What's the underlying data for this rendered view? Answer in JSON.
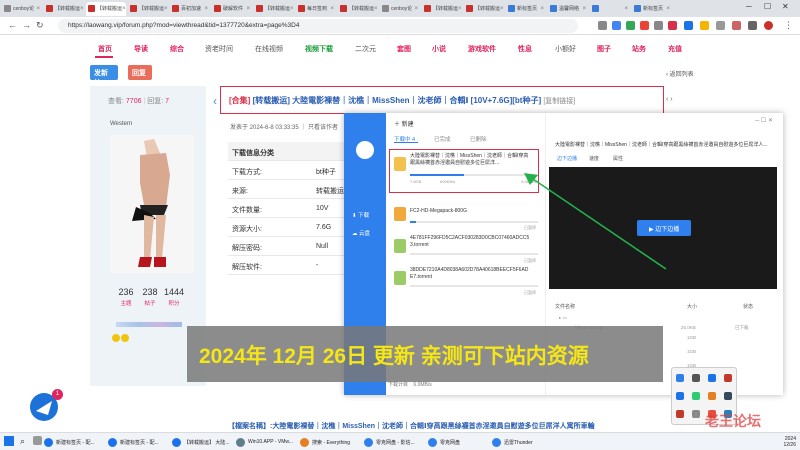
{
  "browser": {
    "tabs": [
      {
        "label": "cenboy论",
        "color": "#888"
      },
      {
        "label": "【转载搬运",
        "color": "#c9302c"
      },
      {
        "label": "【转载搬运",
        "color": "#c9302c"
      },
      {
        "label": "【转载搬运",
        "color": "#c9302c"
      },
      {
        "label": "百初加速",
        "color": "#c9302c"
      },
      {
        "label": "破解软件",
        "color": "#c9302c"
      },
      {
        "label": "【转载搬运",
        "color": "#c9302c"
      },
      {
        "label": "每日签到",
        "color": "#c9302c"
      },
      {
        "label": "【转载搬运",
        "color": "#c9302c"
      },
      {
        "label": "cenboy论",
        "color": "#888"
      },
      {
        "label": "【转载搬运",
        "color": "#c9302c"
      },
      {
        "label": "【转载搬运",
        "color": "#c9302c"
      },
      {
        "label": "新标签页",
        "color": "#3a7bd5"
      },
      {
        "label": "温馨网络",
        "color": "#3a7bd5"
      },
      {
        "label": "",
        "color": "#3a7bd5"
      },
      {
        "label": "新标签页",
        "color": "#3a7bd5"
      }
    ],
    "url": "https://laowang.vip/forum.php?mod=viewthread&tid=1377720&extra=page%3D4"
  },
  "site_nav": {
    "items": [
      "首页",
      "导读",
      "综合",
      "资老时间",
      "在线视频",
      "视频下载",
      "二次元",
      "套图",
      "小说",
      "游戏软件",
      "性息",
      "小额好",
      "图子",
      "站务",
      "充值"
    ]
  },
  "actions": {
    "post": "发新帖",
    "reply": "回复",
    "back_list": "返回列表"
  },
  "user": {
    "views_label": "查看:",
    "views": "7706",
    "replies_label": "回复:",
    "replies": "7",
    "name": "Western",
    "stats": [
      {
        "value": "236",
        "label": "主题"
      },
      {
        "value": "238",
        "label": "帖子"
      },
      {
        "value": "1444",
        "label": "积分"
      }
    ]
  },
  "thread": {
    "category": "[合集]",
    "title": "[转载搬运] 大陸電影裸替｜沈樵｜MissShen｜沈老師｜合輯Ⅰ [10V+7.6G][bt种子]",
    "copy_link": "[复制链接]",
    "meta": "发表于 2024-6-8 03:33:35 ｜ 只看该作者",
    "info_header": "下载信息分类",
    "info": [
      {
        "key": "下载方式:",
        "value": "bt种子"
      },
      {
        "key": "来源:",
        "value": "转载搬运"
      },
      {
        "key": "文件数量:",
        "value": "10V"
      },
      {
        "key": "资源大小:",
        "value": "7.6G"
      },
      {
        "key": "解压密码:",
        "value": "Null"
      },
      {
        "key": "解压软件:",
        "value": "-"
      }
    ]
  },
  "downloader": {
    "new_label": "新建",
    "side": [
      "下载",
      "云盘"
    ],
    "tabs": [
      "下载中 4",
      "已完成",
      "已删除"
    ],
    "items": [
      {
        "name": "大陸電影裸替｜沈樵｜MissShen｜沈老師｜合輯Ⅰ穿高跟黑絲襪首赤淫邀員自慰遊多位巨屌洋...",
        "size": "7.6GB",
        "speed": "600KB/s",
        "status": "6.0MB/s",
        "progress": 0.42
      },
      {
        "name": "FC2-HD-Megapack-800G",
        "size": "",
        "speed": "",
        "status": "已暂停",
        "progress": 0.05
      },
      {
        "name": "4E781FF296FD5C2ACF030283D0CBC07460ADCC53.torrent",
        "size": "",
        "speed": "",
        "status": "已暂停",
        "progress": 0.0
      },
      {
        "name": "38DDE7210A4D8038A602D78A40618BEECF5F6ADE7.torrent",
        "size": "",
        "speed": "",
        "status": "已暂停",
        "progress": 0.0
      }
    ],
    "detail_title": "大陸電影裸替｜沈樵｜MissShen｜沈老師｜合輯Ⅰ穿高跟黑絲襪首赤淫邀員自慰遊多位巨屌洋人...",
    "detail_tabs": [
      "边下边播",
      "速度",
      "属性"
    ],
    "play_label": "边下边播",
    "file_header": {
      "name": "文件名称",
      "size": "大小",
      "status": "状态"
    },
    "files": [
      {
        "name": "folder",
        "size": "",
        "status": ""
      },
      {
        "name": "fdhsp.net.png",
        "size": "25.0KB",
        "status": "已下载"
      },
      {
        "name": "",
        "size": "1GB",
        "status": ""
      },
      {
        "name": "",
        "size": "1GB",
        "status": ""
      },
      {
        "name": "",
        "size": "1GB",
        "status": ""
      }
    ],
    "total": "下载计目",
    "total_speed": "6.0MB/s"
  },
  "banner": {
    "text": "2024年 12月 26日 更新 亲测可下站内资源"
  },
  "bottom_line": "【檔案名稱】:大陸電影裸替｜沈樵｜MissShen｜沈老師｜合輯Ⅰ穿高跟黑絲襪首赤淫邀員自慰遊多位巨屌洋人寓所車輪",
  "watermark": "老王论坛",
  "float_badge": "1",
  "taskbar": {
    "items": [
      {
        "label": "新建标签页 - 配...",
        "color": "#1a73e8"
      },
      {
        "label": "新建标签页 - 配...",
        "color": "#1a73e8"
      },
      {
        "label": "【转载搬运】 大陆...",
        "color": "#1a73e8"
      },
      {
        "label": "Win10.APP - VMw...",
        "color": "#607d8b"
      },
      {
        "label": "搜索 - Everything",
        "color": "#e67e22"
      },
      {
        "label": "零克网盘 - 影信...",
        "color": "#2f80ed"
      },
      {
        "label": "零克网盘",
        "color": "#2f80ed"
      },
      {
        "label": "迅雷Thunder",
        "color": "#2f80ed"
      }
    ],
    "time": "2024",
    "date": "12/26"
  }
}
